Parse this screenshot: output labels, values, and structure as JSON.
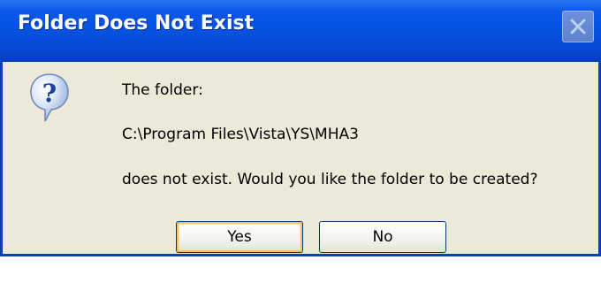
{
  "window": {
    "title": "Folder Does Not Exist",
    "close_icon": "close-icon"
  },
  "message": {
    "icon": "question-icon",
    "line1": "The folder:",
    "path": "C:\\Program Files\\Vista\\YS\\MHA3",
    "line3": "does not exist. Would you like the folder to be created?"
  },
  "buttons": {
    "yes_label": "Yes",
    "no_label": "No",
    "default": "Yes"
  },
  "colors": {
    "titlebar": "#0652e0",
    "frame": "#0a3fb8",
    "body": "#ece9d8",
    "default_button_focus": "#f5c46a"
  }
}
